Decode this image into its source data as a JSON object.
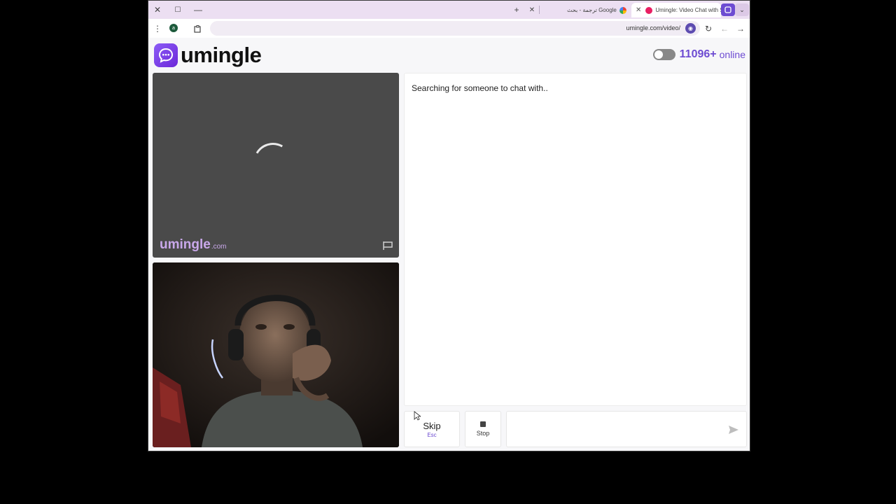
{
  "browser": {
    "tabs": [
      {
        "title": "Umingle: Video Chat with St",
        "active": true
      },
      {
        "title": "ترجمة - بحث Google",
        "active": false
      }
    ],
    "url": "umingle.com/video/",
    "profile_initial": "a"
  },
  "header": {
    "logo_text": "umingle",
    "online_count": "11096+",
    "online_label": "online"
  },
  "remote_video": {
    "watermark_main": "umingle",
    "watermark_sub": ".com"
  },
  "chat": {
    "status_text": "Searching for someone to chat with..",
    "message_placeholder": ""
  },
  "controls": {
    "skip_label": "Skip",
    "skip_key": "Esc",
    "stop_label": "Stop"
  },
  "colors": {
    "brand": "#6d4bd2",
    "tabstrip": "#ecdff2"
  }
}
